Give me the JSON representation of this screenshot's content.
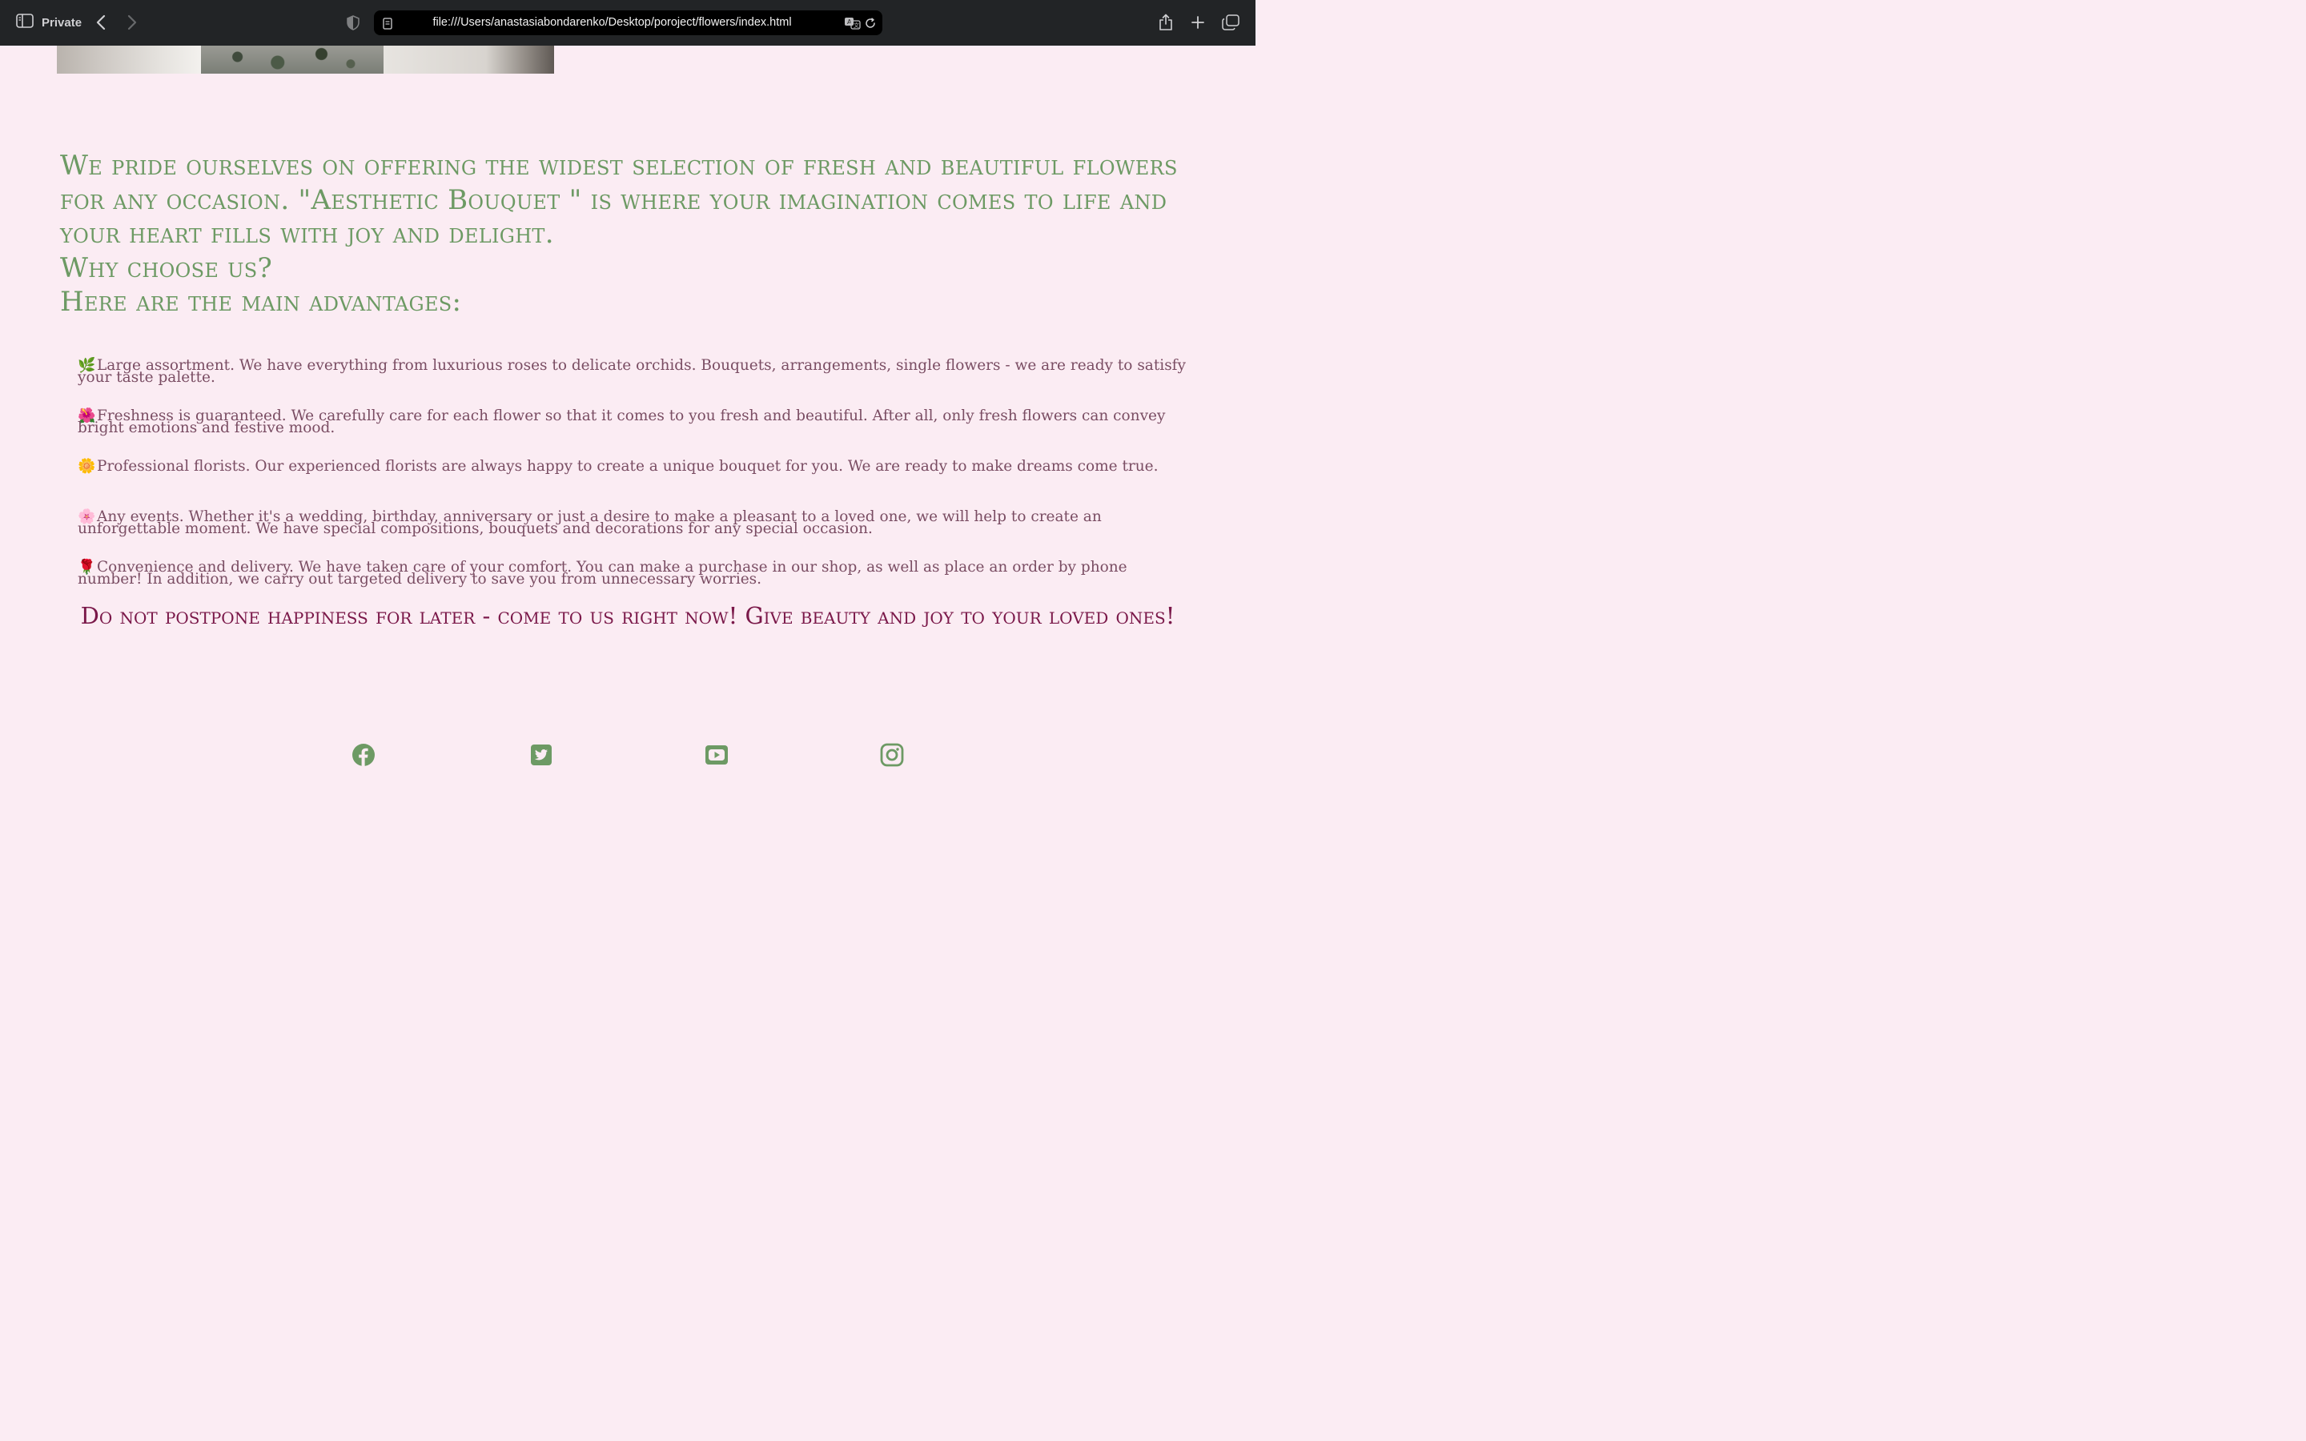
{
  "browser": {
    "mode_label": "Private",
    "url": "file:///Users/anastasiabondarenko/Desktop/poroject/flowers/index.html"
  },
  "intro": {
    "line1": "We pride ourselves on offering the widest selection of fresh and beautiful flowers for any occasion. \"Aesthetic Bouquet \" is where your imagination comes to life and your heart fills with joy and delight.",
    "line2": "Why choose us?",
    "line3": "Here are the main advantages:"
  },
  "advantages": [
    {
      "emoji": "🌿",
      "text": "Large assortment. We have everything from luxurious roses to delicate orchids. Bouquets, arrangements, single flowers - we are ready to satisfy your taste palette."
    },
    {
      "emoji": "🌺",
      "text": "Freshness is guaranteed. We carefully care for each flower so that it comes to you fresh and beautiful. After all, only fresh flowers can convey bright emotions and festive mood."
    },
    {
      "emoji": "🌼",
      "text": "Professional florists. Our experienced florists are always happy to create a unique bouquet for you. We are ready to make dreams come true."
    },
    {
      "emoji": "🌸",
      "text": "Any events. Whether it's a wedding, birthday, anniversary or just a desire to make a pleasant to a loved one, we will help to create an unforgettable moment. We have special compositions, bouquets and decorations for any special occasion."
    },
    {
      "emoji": "🌹",
      "text": "Convenience and delivery. We have taken care of your comfort. You can make a purchase in our shop, as well as place an order by phone number! In addition, we carry out targeted delivery to save you from unnecessary worries."
    }
  ],
  "cta": "Do not postpone happiness for later - come to us right now! Give beauty and joy to your loved ones!",
  "social": {
    "icons": [
      "facebook-icon",
      "twitter-icon",
      "youtube-icon",
      "instagram-icon"
    ],
    "color": "#6d9a64"
  },
  "colors": {
    "background": "#fbecf3",
    "heading": "#6d9a64",
    "body_text": "#7a4d63",
    "cta": "#7a1849"
  }
}
